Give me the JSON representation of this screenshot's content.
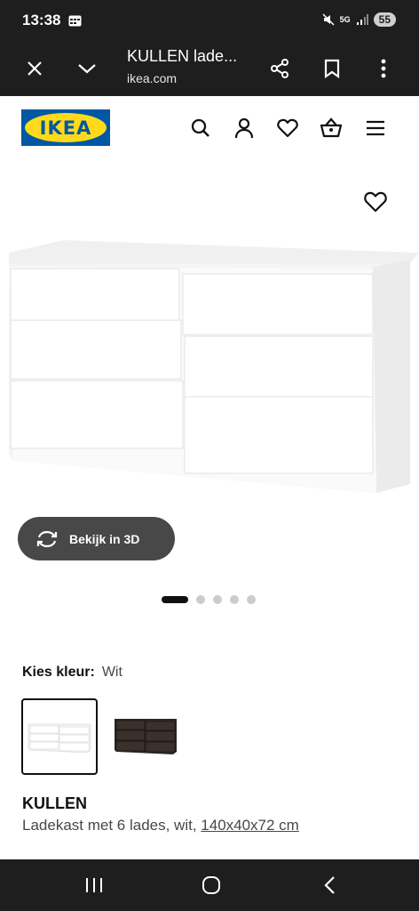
{
  "status_bar": {
    "time": "13:38",
    "network": "5G",
    "battery": "55"
  },
  "browser_bar": {
    "title": "KULLEN lade...",
    "domain": "ikea.com"
  },
  "site_header": {
    "logo_text": "IKEA"
  },
  "gallery": {
    "view_3d_label": "Bekijk in 3D",
    "slide_count": 5,
    "active_slide": 1
  },
  "color_picker": {
    "label": "Kies kleur:",
    "selected_value": "Wit",
    "options": [
      "white",
      "black-brown"
    ]
  },
  "product": {
    "name": "KULLEN",
    "description": "Ladekast met 6 lades, wit, ",
    "dimensions": "140x40x72 cm"
  },
  "colors": {
    "brand_blue": "#0058a3",
    "brand_yellow": "#ffda1a",
    "dark_bar": "#1e1e1e",
    "button_gray": "#484848"
  }
}
